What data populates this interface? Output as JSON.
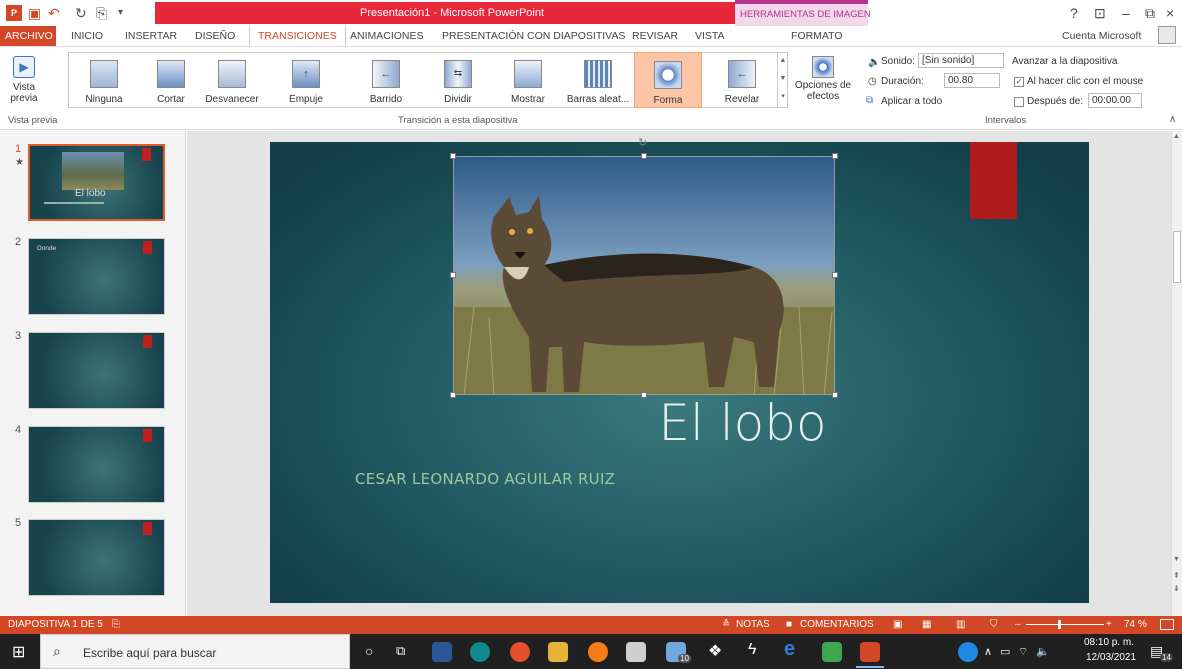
{
  "title_bar": {
    "window_title": "Presentación1 - Microsoft PowerPoint",
    "context_tab_group": "HERRAMIENTAS DE IMAGEN",
    "help": "?",
    "ribbon_options": "⊡",
    "minimize": "–",
    "restore": "⧉",
    "close": "×"
  },
  "tabs": {
    "archivo": "ARCHIVO",
    "items": [
      "INICIO",
      "INSERTAR",
      "DISEÑO",
      "TRANSICIONES",
      "ANIMACIONES",
      "PRESENTACIÓN CON DIAPOSITIVAS",
      "REVISAR",
      "VISTA",
      "FORMATO"
    ],
    "account": "Cuenta Microsoft"
  },
  "ribbon": {
    "preview_label": "Vista previa",
    "preview_group": "Vista previa",
    "transitions": [
      "Ninguna",
      "Cortar",
      "Desvanecer",
      "Empuje",
      "Barrido",
      "Dividir",
      "Mostrar",
      "Barras aleat...",
      "Forma",
      "Revelar"
    ],
    "transition_group": "Transición a esta diapositiva",
    "effect_options": "Opciones de efectos",
    "sound_label": "Sonido:",
    "sound_value": "[Sin sonido]",
    "duration_label": "Duración:",
    "duration_value": "00.80",
    "apply_all": "Aplicar a todo",
    "advance_title": "Avanzar a la diapositiva",
    "on_click": "Al hacer clic con el mouse",
    "after_label": "Después de:",
    "after_value": "00:00.00",
    "timing_group": "Intervalos"
  },
  "thumbnails": [
    {
      "num": "1",
      "title": "El lobo"
    },
    {
      "num": "2",
      "title": "Donde"
    },
    {
      "num": "3",
      "title": ""
    },
    {
      "num": "4",
      "title": ""
    },
    {
      "num": "5",
      "title": ""
    }
  ],
  "slide": {
    "title": "El lobo",
    "subtitle": "CESAR LEONARDO AGUILAR RUIZ"
  },
  "status": {
    "slide_counter": "DIAPOSITIVA 1 DE 5",
    "notes": "NOTAS",
    "comments": "COMENTARIOS",
    "zoom": "74 %"
  },
  "taskbar": {
    "search_placeholder": "Escribe aquí para buscar",
    "time": "08:10 p. m.",
    "date": "12/03/2021",
    "notification_count": "14",
    "mail_badge": "10"
  }
}
